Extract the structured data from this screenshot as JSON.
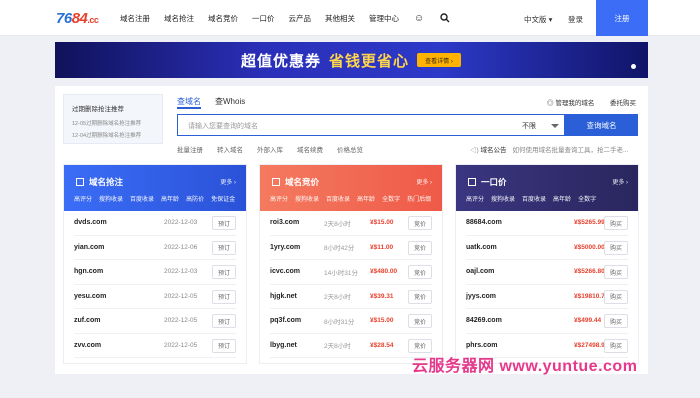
{
  "header": {
    "logo_main": "76",
    "logo_mid": "84",
    "logo_tld": ".cc",
    "nav": [
      "域名注册",
      "域名抢注",
      "域名竞价",
      "一口价",
      "云产品",
      "其他相关",
      "管理中心"
    ],
    "lang": "中文版 ▾",
    "login": "登录",
    "register": "注册"
  },
  "banner": {
    "headline": "超值优惠券",
    "headline2": "省钱更省心",
    "button": "查看详情 ›"
  },
  "left_box": {
    "title": "过期删除抢注推荐",
    "items": [
      "12-05过期删除域名抢注推荐",
      "12-04过期删除域名抢注推荐"
    ]
  },
  "search": {
    "tab_domain": "查域名",
    "tab_whois": "查Whois",
    "manage": "管理我的域名",
    "consign": "委托购买",
    "placeholder": "请输入您要查询的域名",
    "select": "不限",
    "button": "查询域名",
    "sublinks": [
      "批量注册",
      "转入域名",
      "外部入库",
      "域名续费",
      "价格总览"
    ],
    "notice_label": "域名公告",
    "notice_text": "如何使用域名批量查询工具，抢二手老..."
  },
  "columns": [
    {
      "title": "域名抢注",
      "more": "更多 ›",
      "color": "#3b6df6",
      "tags": [
        "高评分",
        "搜狗收录",
        "百度收录",
        "高年龄",
        "高防价",
        "免保证金"
      ],
      "rows": [
        {
          "domain": "dvds.com",
          "info": "2022-12-03",
          "btn": "预订"
        },
        {
          "domain": "yian.com",
          "info": "2022-12-06",
          "btn": "预订"
        },
        {
          "domain": "hgn.com",
          "info": "2022-12-03",
          "btn": "预订"
        },
        {
          "domain": "yesu.com",
          "info": "2022-12-05",
          "btn": "预订"
        },
        {
          "domain": "zuf.com",
          "info": "2022-12-05",
          "btn": "预订"
        },
        {
          "domain": "zvv.com",
          "info": "2022-12-05",
          "btn": "预订"
        }
      ]
    },
    {
      "title": "域名竞价",
      "more": "更多 ›",
      "color": "#f26b55",
      "tags": [
        "高评分",
        "搜狗收录",
        "百度收录",
        "高年龄",
        "全数字",
        "热门后缀"
      ],
      "rows": [
        {
          "domain": "roi3.com",
          "time": "2天8小时",
          "price": "¥$15.00",
          "btn": "竞价"
        },
        {
          "domain": "1yry.com",
          "time": "8小时42分",
          "price": "¥$11.00",
          "btn": "竞价"
        },
        {
          "domain": "icvc.com",
          "time": "14小时31分",
          "price": "¥$480.00",
          "btn": "竞价"
        },
        {
          "domain": "hjgk.net",
          "time": "2天8小时",
          "price": "¥$39.31",
          "btn": "竞价"
        },
        {
          "domain": "pq3f.com",
          "time": "8小时31分",
          "price": "¥$15.00",
          "btn": "竞价"
        },
        {
          "domain": "lbyg.net",
          "time": "2天8小时",
          "price": "¥$28.54",
          "btn": "竞价"
        }
      ]
    },
    {
      "title": "一口价",
      "more": "更多 ›",
      "color": "#34306e",
      "tags": [
        "高评分",
        "搜狗收录",
        "百度收录",
        "高年龄",
        "全数字"
      ],
      "rows": [
        {
          "domain": "88684.com",
          "price": "¥$5265.99",
          "btn": "购买"
        },
        {
          "domain": "uatk.com",
          "price": "¥$5000.00",
          "btn": "购买"
        },
        {
          "domain": "oajl.com",
          "price": "¥$5266.80",
          "btn": "购买"
        },
        {
          "domain": "jyys.com",
          "price": "¥$19810.70",
          "btn": "购买"
        },
        {
          "domain": "84269.com",
          "price": "¥$499.44",
          "btn": "购买"
        },
        {
          "domain": "phrs.com",
          "price": "¥$27498.90",
          "btn": "购买"
        }
      ]
    }
  ],
  "watermark": "云服务器网 www.yuntue.com"
}
